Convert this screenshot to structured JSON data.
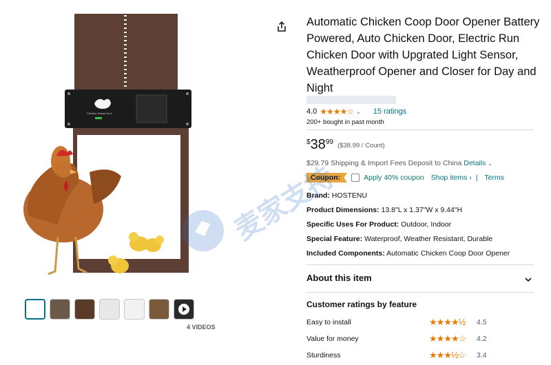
{
  "product": {
    "title": "Automatic Chicken Coop Door Opener Battery Powered, Auto Chicken Door, Electric Run Chicken Door with Upgrated Light Sensor, Weatherproof Opener and Closer for Day and Night",
    "rating_value": "4.0",
    "rating_stars": "★★★★☆",
    "ratings_count": "15 ratings",
    "bought": "200+ bought in past month",
    "device_label": "Chicken House Door"
  },
  "price": {
    "currency": "$",
    "whole": "38",
    "fraction": "99",
    "per_unit": "($38.99 / Count)"
  },
  "shipping": {
    "text": "$29.79 Shipping & Import Fees Deposit to China",
    "details_link": "Details"
  },
  "coupon": {
    "badge": "Coupon:",
    "apply_text": "Apply 40% coupon",
    "shop_items": "Shop items ›",
    "separator": "|",
    "terms": "Terms"
  },
  "specs": [
    {
      "label": "Brand:",
      "value": "HOSTENU"
    },
    {
      "label": "Product Dimensions:",
      "value": "13.8\"L x 1.37\"W x 9.44\"H"
    },
    {
      "label": "Specific Uses For Product:",
      "value": "Outdoor, Indoor"
    },
    {
      "label": "Special Feature:",
      "value": "Waterproof, Weather Resistant, Durable"
    },
    {
      "label": "Included Components:",
      "value": "Automatic Chicken Coop Door Opener"
    }
  ],
  "about": {
    "title": "About this item"
  },
  "ratings_by_feature": {
    "title": "Customer ratings by feature",
    "items": [
      {
        "label": "Easy to install",
        "stars": "★★★★½",
        "value": "4.5"
      },
      {
        "label": "Value for money",
        "stars": "★★★★☆",
        "value": "4.2"
      },
      {
        "label": "Sturdiness",
        "stars": "★★★½☆",
        "value": "3.4"
      }
    ]
  },
  "gallery": {
    "videos_label": "4 VIDEOS",
    "thumbnail_count": 7
  },
  "watermark": {
    "text": "麦家支持"
  },
  "colors": {
    "link": "#007185",
    "star": "#e67a00",
    "coupon_badge": "#e9a63c",
    "green": "#067d62"
  }
}
